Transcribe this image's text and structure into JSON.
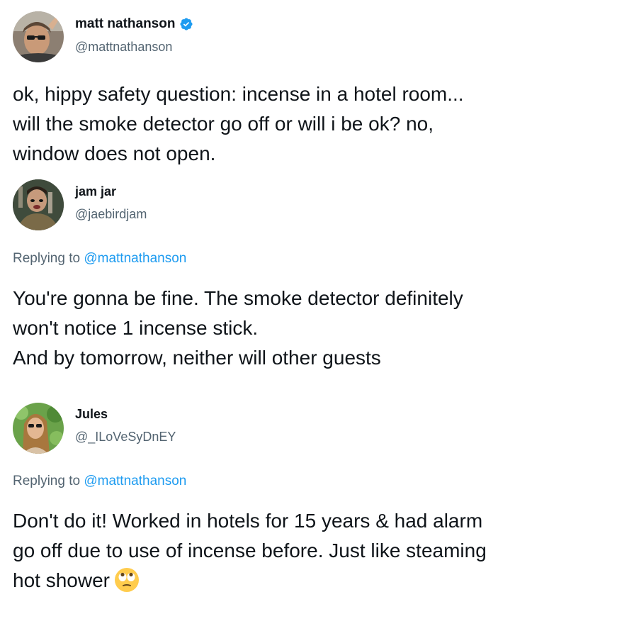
{
  "tweets": [
    {
      "author": "matt nathanson",
      "handle": "@mattnathanson",
      "verified": true,
      "avatar_icon": "profile-photo",
      "lines": [
        "ok, hippy safety question: incense in a hotel room...",
        "will the smoke detector go off or will i be ok? no,",
        "window does not open."
      ]
    },
    {
      "author": "jam jar",
      "handle": "@jaebirdjam",
      "avatar_icon": "profile-photo",
      "replying_prefix": "Replying to",
      "replying_to": "@mattnathanson",
      "lines": [
        "You're gonna be fine. The smoke detector definitely",
        "won't notice 1 incense stick.",
        "And by tomorrow, neither will other guests"
      ]
    },
    {
      "author": "Jules",
      "handle": "@_ILoVeSyDnEY",
      "avatar_icon": "profile-photo",
      "replying_prefix": "Replying to",
      "replying_to": "@mattnathanson",
      "lines": [
        "Don't do it! Worked in hotels for 15 years & had alarm",
        "go off due to use of incense before. Just like steaming",
        "hot shower"
      ],
      "trailing_emoji": "face-with-rolling-eyes-emoji"
    }
  ],
  "colors": {
    "text": "#0f1419",
    "secondary": "#536471",
    "link": "#1d9bf0",
    "verified": "#1d9bf0"
  }
}
